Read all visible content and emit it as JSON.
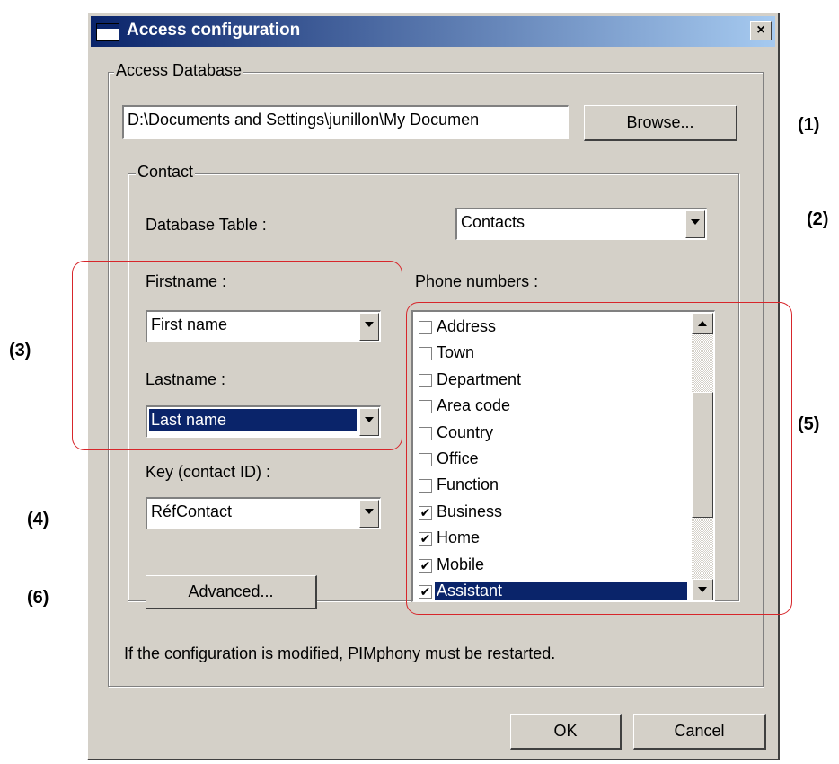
{
  "window": {
    "title": "Access configuration",
    "close_label": "×"
  },
  "access_db": {
    "legend": "Access Database",
    "path_value": "D:\\Documents and Settings\\junillon\\My Documen",
    "browse_label": "Browse..."
  },
  "contact": {
    "legend": "Contact",
    "table_label": "Database Table :",
    "table_value": "Contacts",
    "firstname_label": "Firstname :",
    "firstname_value": "First name",
    "lastname_label": "Lastname :",
    "lastname_value": "Last name",
    "key_label": "Key (contact ID) :",
    "key_value": "RéfContact",
    "advanced_label": "Advanced...",
    "phone_label": "Phone numbers :",
    "phone_items": [
      {
        "label": "Address",
        "checked": false,
        "selected": false
      },
      {
        "label": "Town",
        "checked": false,
        "selected": false
      },
      {
        "label": "Department",
        "checked": false,
        "selected": false
      },
      {
        "label": "Area code",
        "checked": false,
        "selected": false
      },
      {
        "label": "Country",
        "checked": false,
        "selected": false
      },
      {
        "label": "Office",
        "checked": false,
        "selected": false
      },
      {
        "label": "Function",
        "checked": false,
        "selected": false
      },
      {
        "label": "Business",
        "checked": true,
        "selected": false
      },
      {
        "label": "Home",
        "checked": true,
        "selected": false
      },
      {
        "label": "Mobile",
        "checked": true,
        "selected": false
      },
      {
        "label": "Assistant",
        "checked": true,
        "selected": true
      }
    ]
  },
  "note": "If the configuration is modified, PIMphony must be restarted.",
  "footer": {
    "ok_label": "OK",
    "cancel_label": "Cancel"
  },
  "markers": {
    "m1": "(1)",
    "m2": "(2)",
    "m3": "(3)",
    "m4": "(4)",
    "m5": "(5)",
    "m6": "(6)"
  },
  "colors": {
    "callout": "#d7262b",
    "selection": "#0a246a",
    "face": "#d4d0c8"
  }
}
